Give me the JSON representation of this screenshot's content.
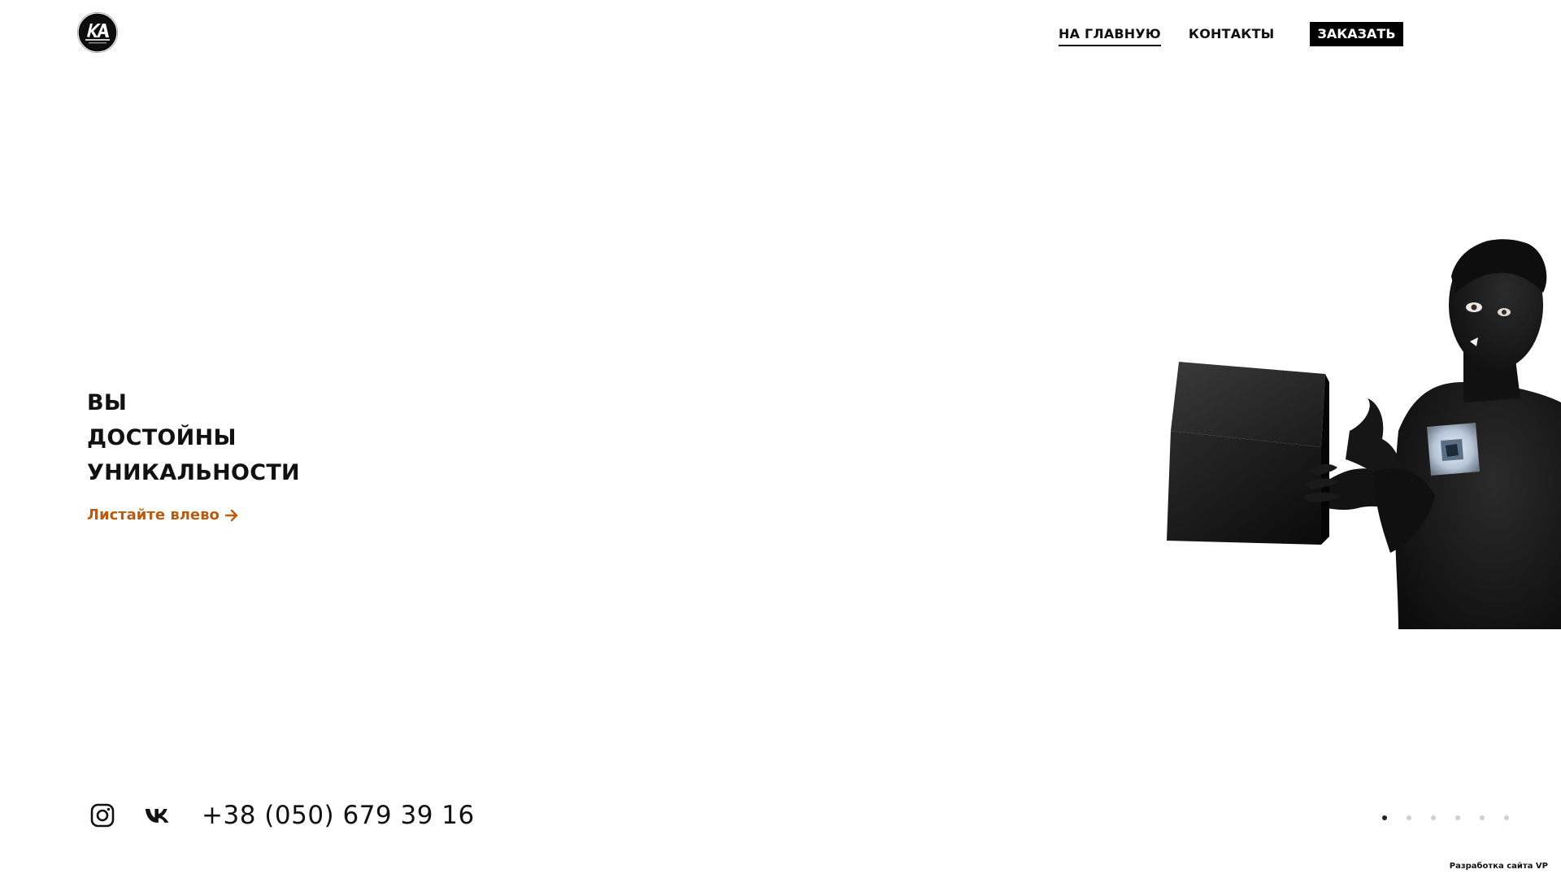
{
  "header": {
    "nav": [
      {
        "label": "НА ГЛАВНУЮ",
        "active": true
      },
      {
        "label": "КОНТАКТЫ",
        "active": false
      }
    ],
    "order_button": "ЗАКАЗАТЬ"
  },
  "hero": {
    "lines": [
      "ВЫ",
      "ДОСТОЙНЫ",
      "УНИКАЛЬНОСТИ"
    ],
    "scroll_hint": "Листайте влево",
    "accent_color": "#b85c12"
  },
  "footer": {
    "social_icons": [
      "instagram-icon",
      "vk-icon"
    ],
    "phone": "+38 (050) 679 39 16",
    "slider": {
      "total": 6,
      "active": 1
    },
    "credit": "Разработка сайта VP"
  }
}
